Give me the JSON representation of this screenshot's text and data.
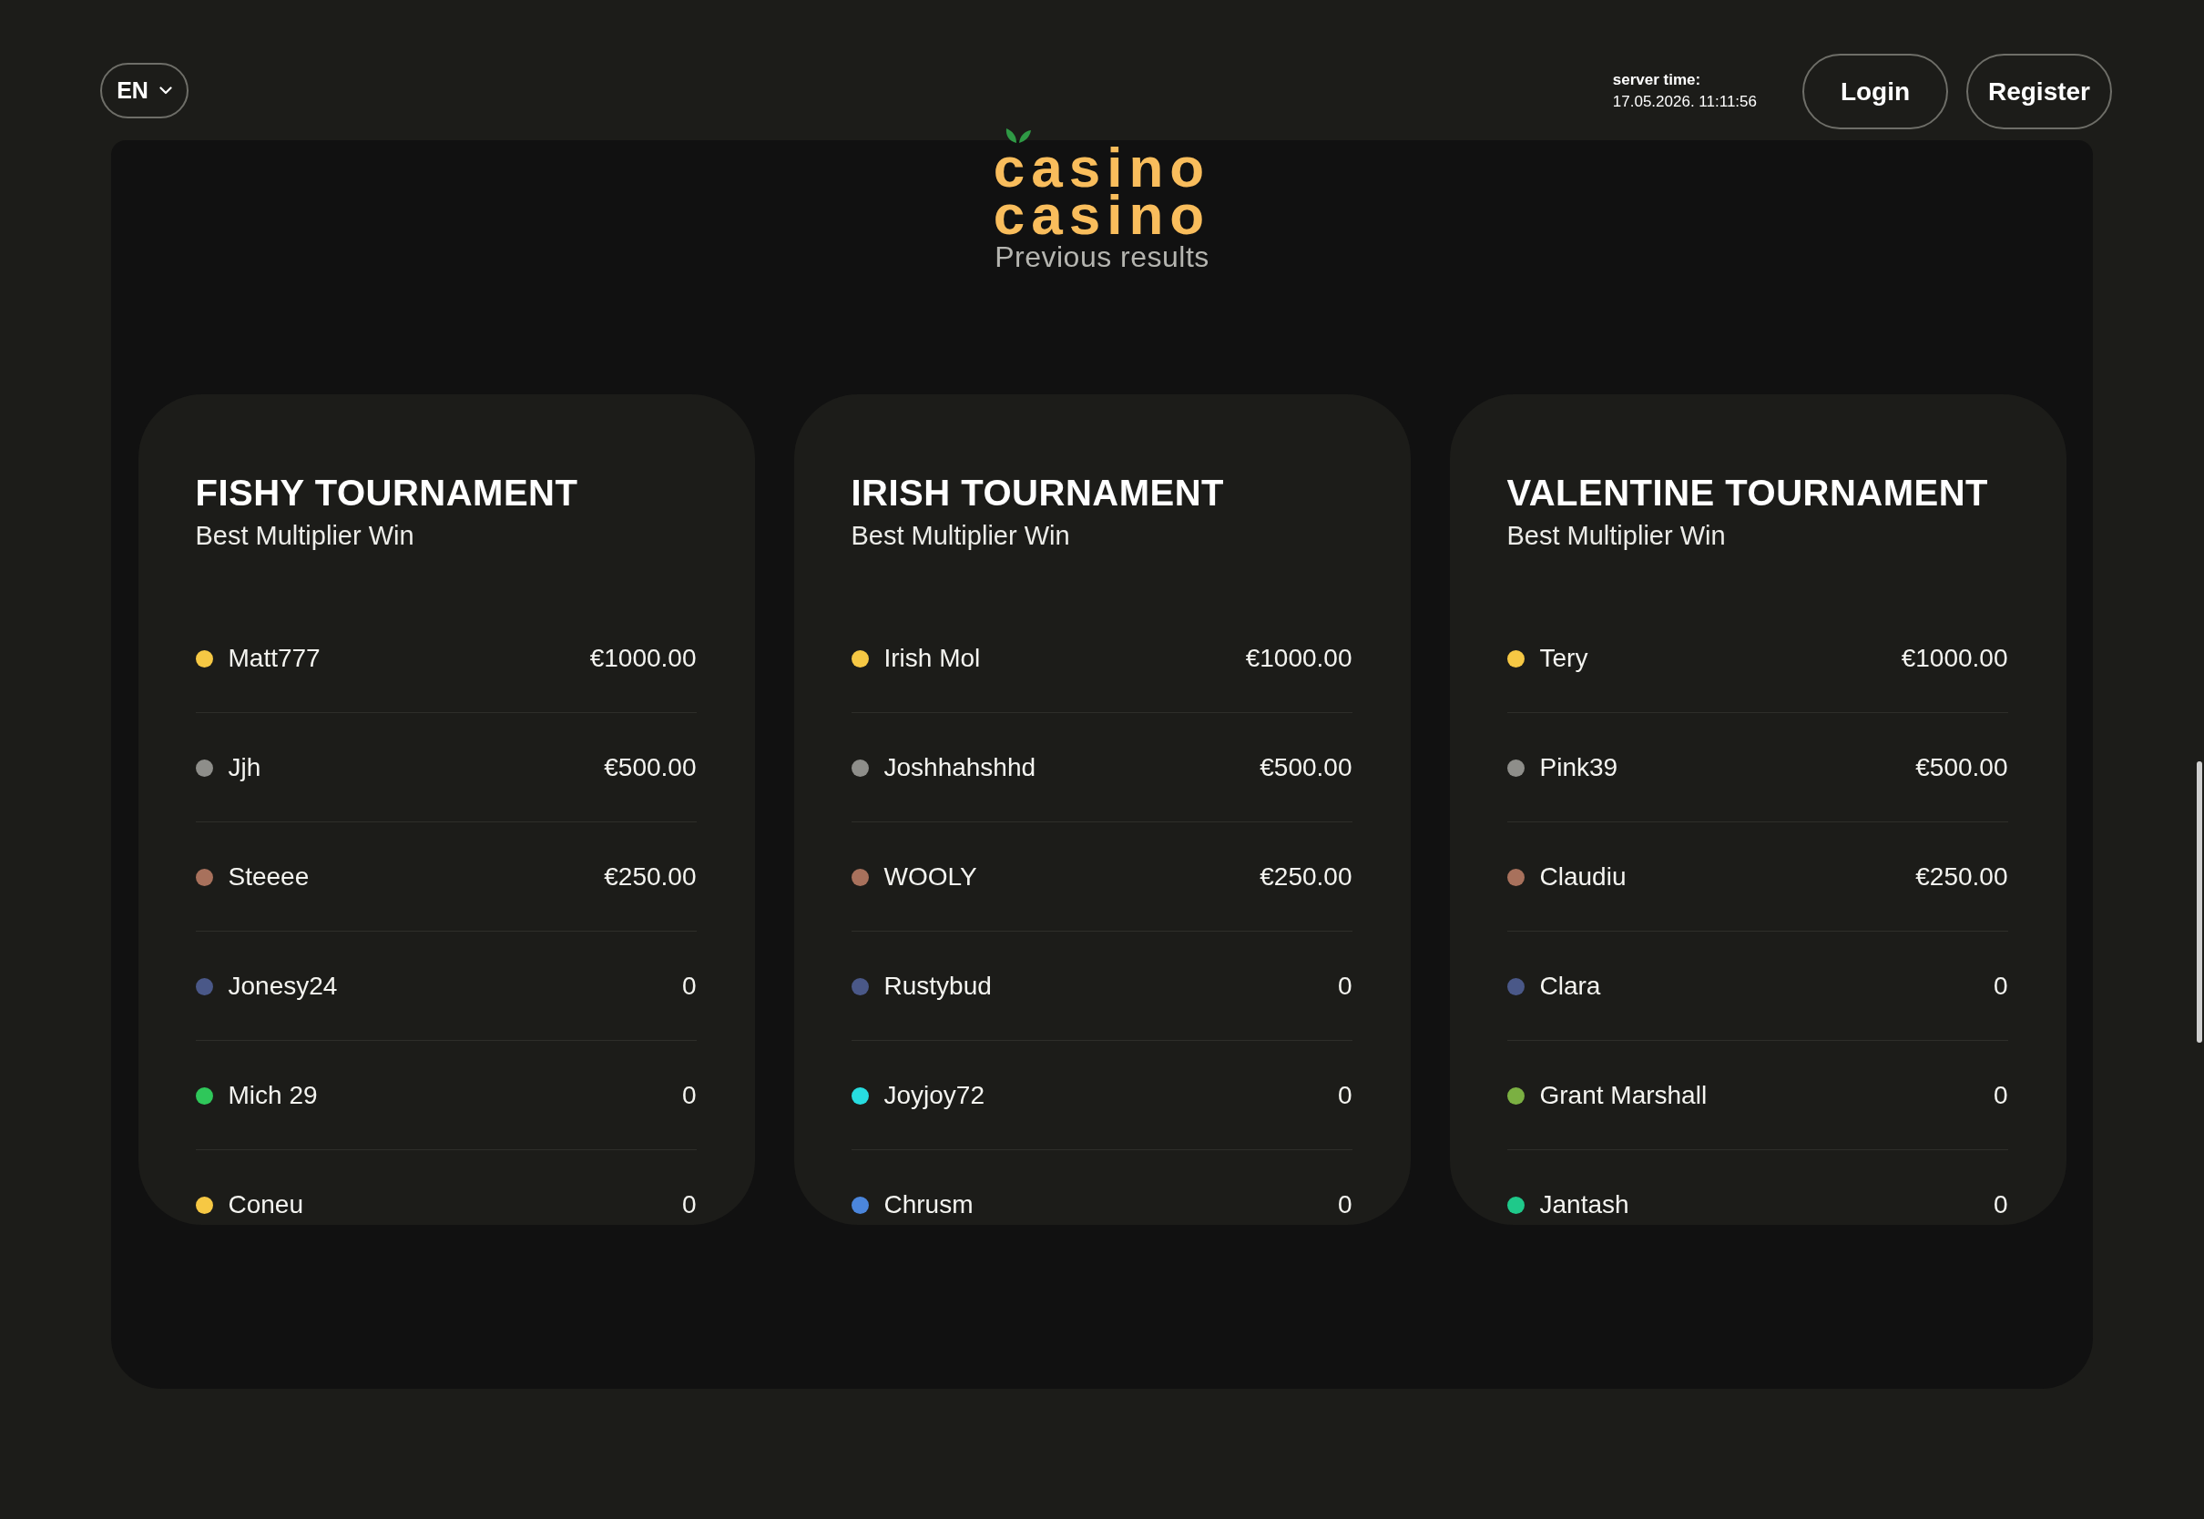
{
  "header": {
    "language": {
      "label": "EN"
    },
    "server_time": {
      "label": "server time:",
      "value": "17.05.2026. 11:11:56"
    },
    "buttons": [
      "Login",
      "Register"
    ]
  },
  "logo": {
    "lines": [
      "casino",
      "casino"
    ]
  },
  "section_title": "Previous results",
  "tournaments": [
    {
      "title": "FISHY TOURNAMENT",
      "subtitle": "Best Multiplier Win",
      "entries": [
        {
          "name": "Matt777",
          "prize": "€1000.00",
          "color": "#f6c844"
        },
        {
          "name": "Jjh",
          "prize": "€500.00",
          "color": "#8e8e8a"
        },
        {
          "name": "Steeee",
          "prize": "€250.00",
          "color": "#a8715c"
        },
        {
          "name": "Jonesy24",
          "prize": "0",
          "color": "#4a5888"
        },
        {
          "name": "Mich 29",
          "prize": "0",
          "color": "#2fc75a"
        },
        {
          "name": "Coneu",
          "prize": "0",
          "color": "#f6c844"
        }
      ]
    },
    {
      "title": "IRISH TOURNAMENT",
      "subtitle": "Best Multiplier Win",
      "entries": [
        {
          "name": "Irish Mol",
          "prize": "€1000.00",
          "color": "#f6c844"
        },
        {
          "name": "Joshhahshhd",
          "prize": "€500.00",
          "color": "#8e8e8a"
        },
        {
          "name": "WOOLY",
          "prize": "€250.00",
          "color": "#a8715c"
        },
        {
          "name": "Rustybud",
          "prize": "0",
          "color": "#4a5888"
        },
        {
          "name": "Joyjoy72",
          "prize": "0",
          "color": "#27dde0"
        },
        {
          "name": "Chrusm",
          "prize": "0",
          "color": "#4b86dc"
        }
      ]
    },
    {
      "title": "VALENTINE TOURNAMENT",
      "subtitle": "Best Multiplier Win",
      "entries": [
        {
          "name": "Tery",
          "prize": "€1000.00",
          "color": "#f6c844"
        },
        {
          "name": "Pink39",
          "prize": "€500.00",
          "color": "#8e8e8a"
        },
        {
          "name": "Claudiu",
          "prize": "€250.00",
          "color": "#a8715c"
        },
        {
          "name": "Clara",
          "prize": "0",
          "color": "#4a5888"
        },
        {
          "name": "Grant Marshall",
          "prize": "0",
          "color": "#7bb042"
        },
        {
          "name": "Jantash",
          "prize": "0",
          "color": "#1fc98a"
        }
      ]
    }
  ]
}
